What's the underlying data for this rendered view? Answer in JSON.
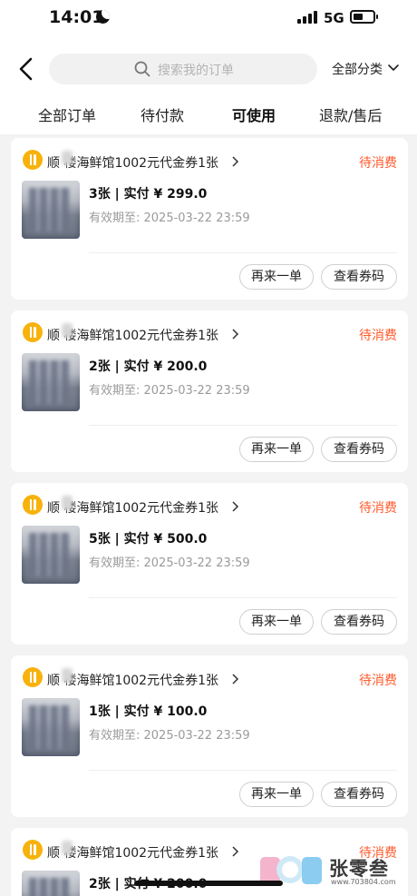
{
  "status_bar": {
    "time": "14:01",
    "network": "5G"
  },
  "nav": {
    "search_placeholder": "搜索我的订单",
    "category_filter": "全部分类"
  },
  "tabs": [
    {
      "label": "全部订单"
    },
    {
      "label": "待付款"
    },
    {
      "label": "可使用",
      "active": true
    },
    {
      "label": "退款/售后"
    }
  ],
  "orders": [
    {
      "shop": "顺 楼海鲜馆1002元代金券1张",
      "status": "待消费",
      "qty_price": "3张 | 实付 ¥ 299.0",
      "validity": "有效期至: 2025-03-22 23:59",
      "btn_reorder": "再来一单",
      "btn_code": "查看券码"
    },
    {
      "shop": "顺 楼海鲜馆1002元代金券1张",
      "status": "待消费",
      "qty_price": "2张 | 实付 ¥ 200.0",
      "validity": "有效期至: 2025-03-22 23:59",
      "btn_reorder": "再来一单",
      "btn_code": "查看券码"
    },
    {
      "shop": "顺 楼海鲜馆1002元代金券1张",
      "status": "待消费",
      "qty_price": "5张 | 实付 ¥ 500.0",
      "validity": "有效期至: 2025-03-22 23:59",
      "btn_reorder": "再来一单",
      "btn_code": "查看券码"
    },
    {
      "shop": "顺 楼海鲜馆1002元代金券1张",
      "status": "待消费",
      "qty_price": "1张 | 实付 ¥ 100.0",
      "validity": "有效期至: 2025-03-22 23:59",
      "btn_reorder": "再来一单",
      "btn_code": "查看券码"
    },
    {
      "shop": "顺 楼海鲜馆1002元代金券1张",
      "status": "待消费",
      "qty_price": "2张 | 实付 ¥ 200.0",
      "validity": "",
      "btn_reorder": "",
      "btn_code": ""
    }
  ],
  "watermark": {
    "brand": "张零叁",
    "url": "www.703804.com"
  },
  "colors": {
    "accent": "#ff5a2c",
    "shop_icon": "#f7b20b",
    "background": "#f3f3f3"
  }
}
